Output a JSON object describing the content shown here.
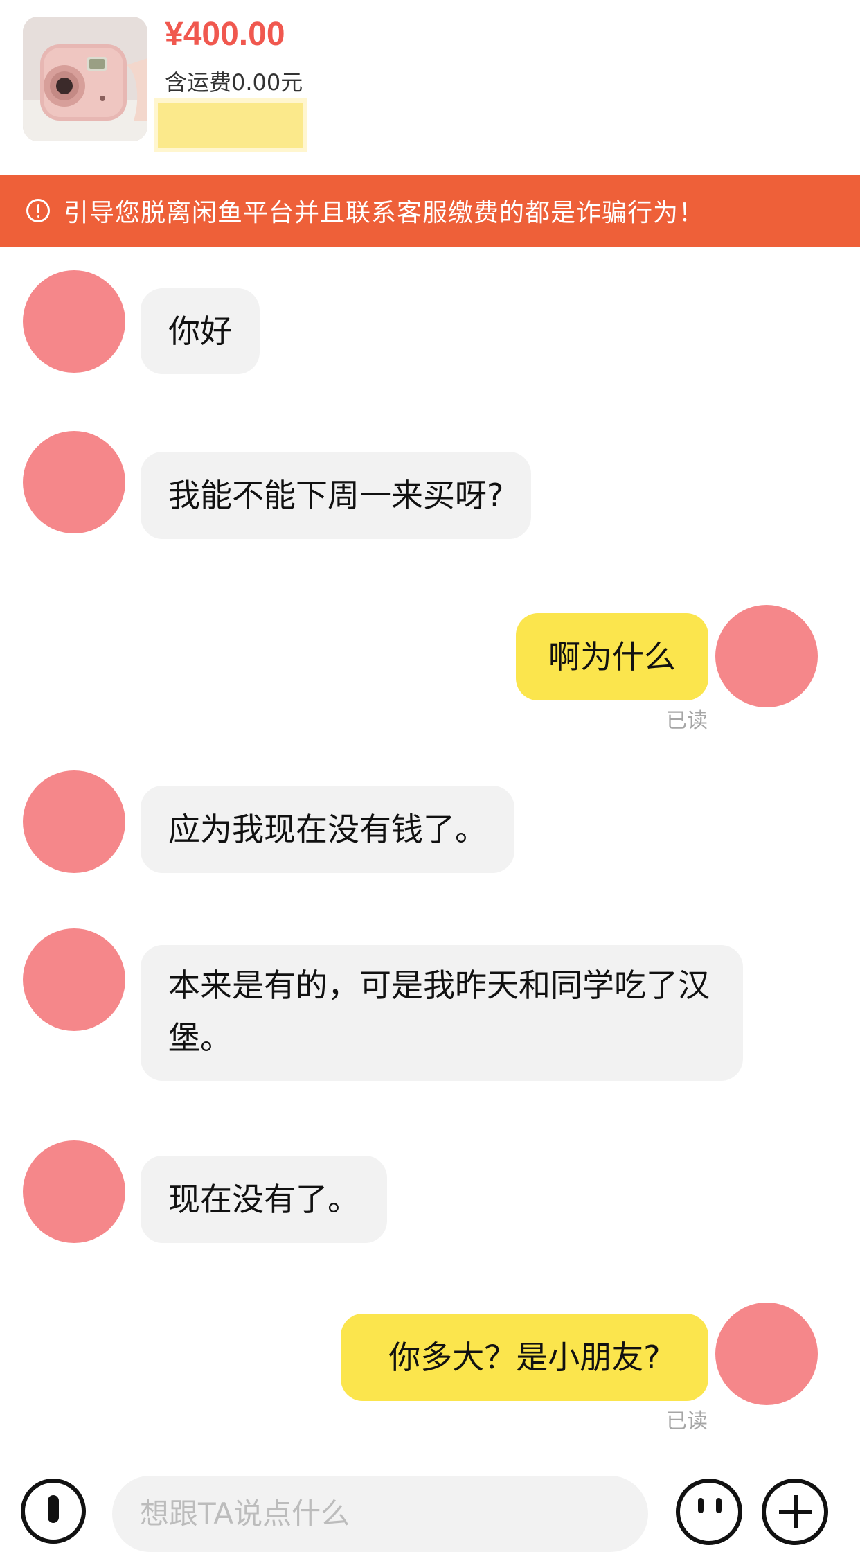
{
  "product": {
    "price": "¥400.00",
    "shipping": "含运费0.00元",
    "image": "pink-instant-camera-photo"
  },
  "banner": {
    "text": "引导您脱离闲鱼平台并且联系客服缴费的都是诈骗行为！",
    "color": "#ee6039",
    "icon": "warning-circle-icon"
  },
  "messages": [
    {
      "side": "in",
      "text": "你好"
    },
    {
      "side": "in",
      "text": "我能不能下周一来买呀?"
    },
    {
      "side": "out",
      "text": "啊为什么",
      "status": "已读"
    },
    {
      "side": "in",
      "text": "应为我现在没有钱了。"
    },
    {
      "side": "in",
      "text": "本来是有的，可是我昨天和同学吃了汉堡。"
    },
    {
      "side": "in",
      "text": "现在没有了。"
    },
    {
      "side": "out",
      "text": "你多大？是小朋友?",
      "status": "已读"
    }
  ],
  "input": {
    "placeholder": "想跟TA说点什么"
  },
  "colors": {
    "incoming_bubble": "#f2f2f2",
    "outgoing_bubble": "#fbe54d",
    "avatar": "#f5878a",
    "price": "#f0584f"
  },
  "icons": {
    "voice": "microphone-icon",
    "emoji": "emoji-icon",
    "more": "plus-icon"
  }
}
